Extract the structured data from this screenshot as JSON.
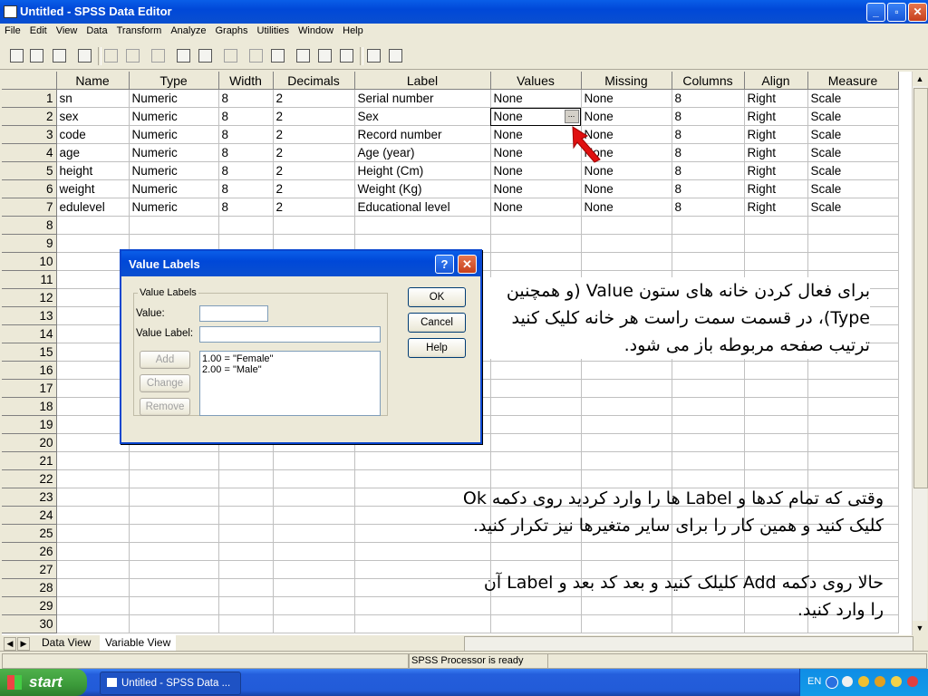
{
  "window": {
    "title": "Untitled - SPSS Data Editor"
  },
  "menu": [
    "File",
    "Edit",
    "View",
    "Data",
    "Transform",
    "Analyze",
    "Graphs",
    "Utilities",
    "Window",
    "Help"
  ],
  "grid": {
    "columns": [
      "Name",
      "Type",
      "Width",
      "Decimals",
      "Label",
      "Values",
      "Missing",
      "Columns",
      "Align",
      "Measure"
    ],
    "rows": [
      [
        "1",
        "sn",
        "Numeric",
        "8",
        "2",
        "Serial number",
        "None",
        "None",
        "8",
        "Right",
        "Scale"
      ],
      [
        "2",
        "sex",
        "Numeric",
        "8",
        "2",
        "Sex",
        "None",
        "None",
        "8",
        "Right",
        "Scale"
      ],
      [
        "3",
        "code",
        "Numeric",
        "8",
        "2",
        "Record number",
        "None",
        "None",
        "8",
        "Right",
        "Scale"
      ],
      [
        "4",
        "age",
        "Numeric",
        "8",
        "2",
        "Age (year)",
        "None",
        "None",
        "8",
        "Right",
        "Scale"
      ],
      [
        "5",
        "height",
        "Numeric",
        "8",
        "2",
        "Height (Cm)",
        "None",
        "None",
        "8",
        "Right",
        "Scale"
      ],
      [
        "6",
        "weight",
        "Numeric",
        "8",
        "2",
        "Weight (Kg)",
        "None",
        "None",
        "8",
        "Right",
        "Scale"
      ],
      [
        "7",
        "edulevel",
        "Numeric",
        "8",
        "2",
        "Educational level",
        "None",
        "None",
        "8",
        "Right",
        "Scale"
      ]
    ],
    "empty_row_numbers": [
      "8",
      "9",
      "10",
      "11",
      "12",
      "13",
      "14",
      "15",
      "16",
      "17",
      "18",
      "19",
      "20",
      "21",
      "22",
      "23",
      "24",
      "25",
      "26",
      "27",
      "28",
      "29",
      "30"
    ],
    "cell_button": "..."
  },
  "tabs": {
    "data_view": "Data View",
    "variable_view": "Variable View"
  },
  "status": {
    "processor": "SPSS Processor  is ready"
  },
  "taskbar": {
    "start": "start",
    "task": "Untitled - SPSS Data ...",
    "lang": "EN"
  },
  "dialog": {
    "title": "Value Labels",
    "help_glyph": "?",
    "close_glyph": "✕",
    "group_label": "Value Labels",
    "value_label": "Value:",
    "value_label_label": "Value Label:",
    "value_input": "",
    "label_input": "",
    "buttons": {
      "ok": "OK",
      "cancel": "Cancel",
      "help": "Help",
      "add": "Add",
      "change": "Change",
      "remove": "Remove"
    },
    "list": [
      "1.00 = \"Female\"",
      "2.00 = \"Male\""
    ]
  },
  "annotations": {
    "text1_line1": "برای فعال کردن خانه های ستون Value (و همچنین",
    "text1_line2": "Type)، در قسمت سمت راست هر خانه کلیک کنید",
    "text1_line3": "ترتیب صفحه مربوطه باز می شود.",
    "text2_line1": "وقتی که تمام کدها و Label ها را وارد کردید روی دکمه Ok",
    "text2_line2": "کلیک کنید و همین کار را برای سایر متغیرها نیز تکرار کنید.",
    "text3_line1": "حالا روی دکمه Add کلیلک کنید و بعد کد بعد و Label آن",
    "text3_line2": "را وارد کنید."
  },
  "colors": {
    "titlebar": "#0a4fd0",
    "arrow": "#e01010",
    "taskbar": "#245edc",
    "start": "#3b9a3a"
  }
}
